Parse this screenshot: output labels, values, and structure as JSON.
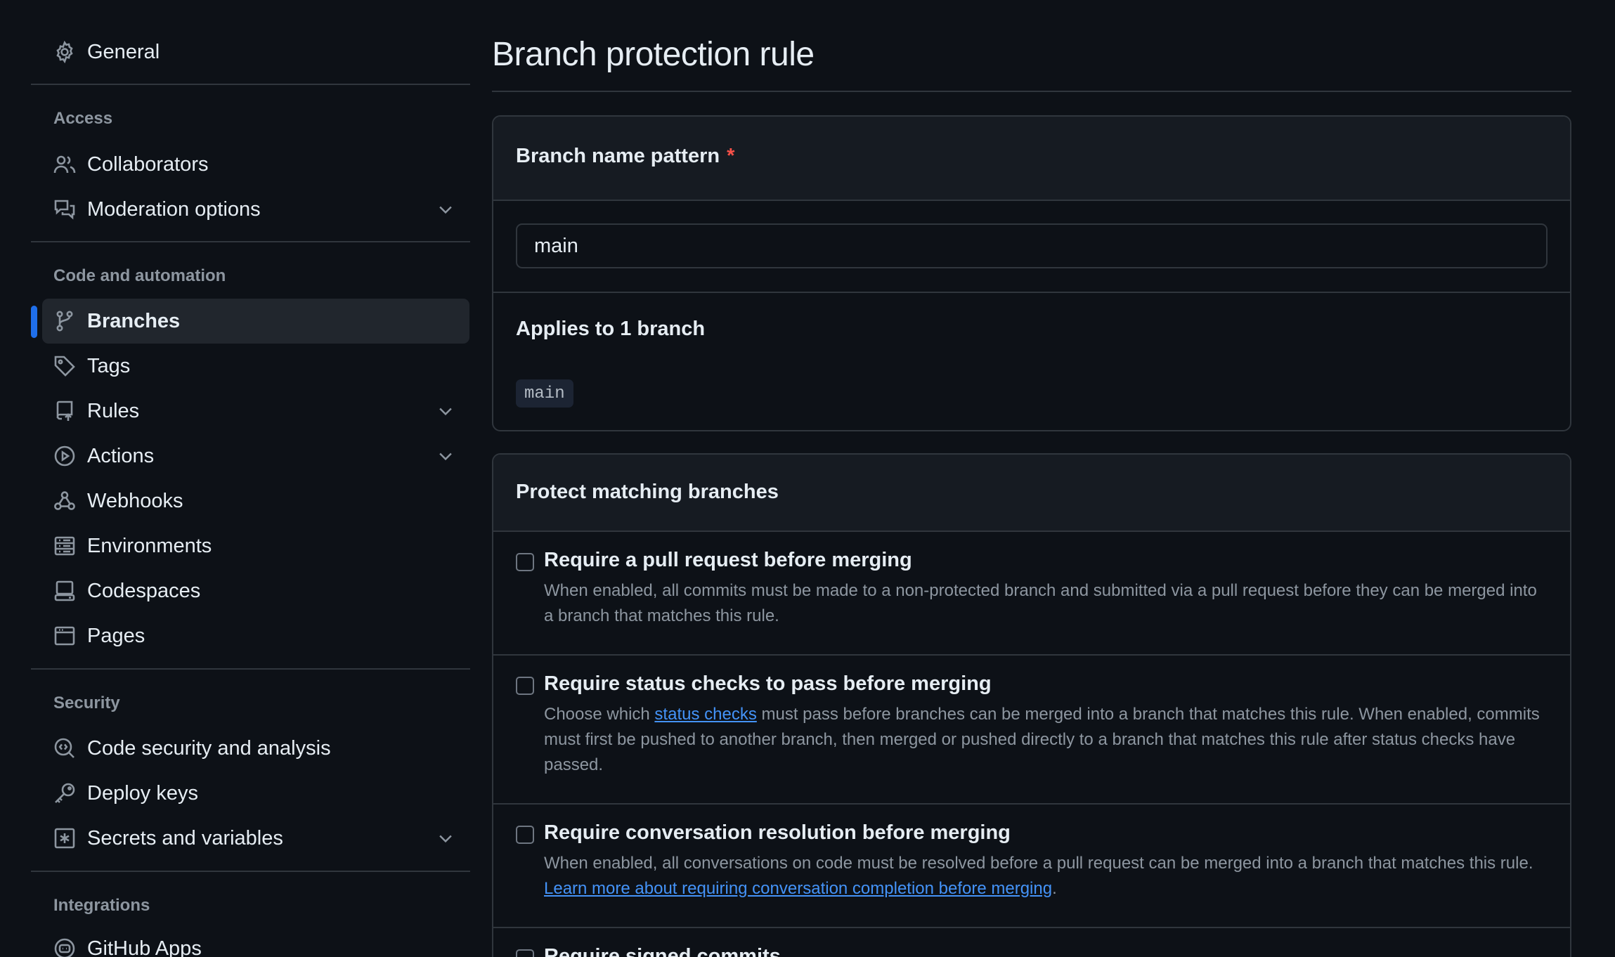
{
  "sidebar": {
    "general": "General",
    "access_heading": "Access",
    "collaborators": "Collaborators",
    "moderation": "Moderation options",
    "code_heading": "Code and automation",
    "branches": "Branches",
    "tags": "Tags",
    "rules": "Rules",
    "actions": "Actions",
    "webhooks": "Webhooks",
    "environments": "Environments",
    "codespaces": "Codespaces",
    "pages": "Pages",
    "security_heading": "Security",
    "code_security": "Code security and analysis",
    "deploy_keys": "Deploy keys",
    "secrets": "Secrets and variables",
    "integrations_heading": "Integrations",
    "github_apps": "GitHub Apps"
  },
  "main": {
    "title": "Branch protection rule",
    "pattern_label": "Branch name pattern",
    "required_mark": "*",
    "pattern_value": "main",
    "applies_text": "Applies to 1 branch",
    "branch_chip": "main",
    "protect_heading": "Protect matching branches",
    "options": [
      {
        "title": "Require a pull request before merging",
        "desc": "When enabled, all commits must be made to a non-protected branch and submitted via a pull request before they can be merged into a branch that matches this rule."
      },
      {
        "title": "Require status checks to pass before merging",
        "desc_before": "Choose which ",
        "desc_link": "status checks",
        "desc_after": " must pass before branches can be merged into a branch that matches this rule. When enabled, commits must first be pushed to another branch, then merged or pushed directly to a branch that matches this rule after status checks have passed."
      },
      {
        "title": "Require conversation resolution before merging",
        "desc_before": "When enabled, all conversations on code must be resolved before a pull request can be merged into a branch that matches this rule. ",
        "desc_link": "Learn more about requiring conversation completion before merging",
        "desc_after": "."
      },
      {
        "title": "Require signed commits"
      }
    ]
  },
  "colors": {
    "background": "#0d1117",
    "accent": "#1f6feb",
    "link": "#4493f8",
    "required": "#f85149"
  }
}
